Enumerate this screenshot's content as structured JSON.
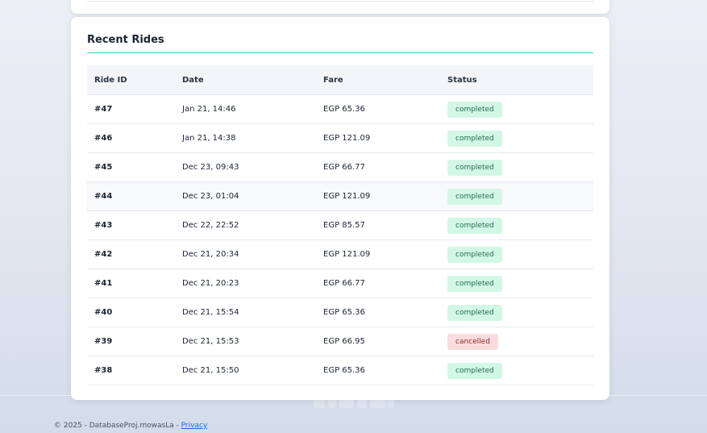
{
  "section_title": "Recent Rides",
  "table": {
    "headers": [
      "Ride ID",
      "Date",
      "Fare",
      "Status"
    ],
    "rows": [
      {
        "id": "#47",
        "date": "Jan 21, 14:46",
        "fare": "EGP 65.36",
        "status": "completed"
      },
      {
        "id": "#46",
        "date": "Jan 21, 14:38",
        "fare": "EGP 121.09",
        "status": "completed"
      },
      {
        "id": "#45",
        "date": "Dec 23, 09:43",
        "fare": "EGP 66.77",
        "status": "completed"
      },
      {
        "id": "#44",
        "date": "Dec 23, 01:04",
        "fare": "EGP 121.09",
        "status": "completed"
      },
      {
        "id": "#43",
        "date": "Dec 22, 22:52",
        "fare": "EGP 85.57",
        "status": "completed"
      },
      {
        "id": "#42",
        "date": "Dec 21, 20:34",
        "fare": "EGP 121.09",
        "status": "completed"
      },
      {
        "id": "#41",
        "date": "Dec 21, 20:23",
        "fare": "EGP 66.77",
        "status": "completed"
      },
      {
        "id": "#40",
        "date": "Dec 21, 15:54",
        "fare": "EGP 65.36",
        "status": "completed"
      },
      {
        "id": "#39",
        "date": "Dec 21, 15:53",
        "fare": "EGP 66.95",
        "status": "cancelled"
      },
      {
        "id": "#38",
        "date": "Dec 21, 15:50",
        "fare": "EGP 65.36",
        "status": "completed"
      }
    ]
  },
  "footer": {
    "text": "© 2025 - DatabaseProj.mowasLa - ",
    "privacy_link": "Privacy"
  },
  "colors": {
    "accent_rule": "#3fc9d0",
    "completed_bg": "#d3f7e6",
    "completed_text": "#1f6f4f",
    "cancelled_bg": "#fbdcdc",
    "cancelled_text": "#8a2a2a",
    "link": "#2a63d6"
  },
  "icons": {
    "watermark": "logo-watermark"
  }
}
